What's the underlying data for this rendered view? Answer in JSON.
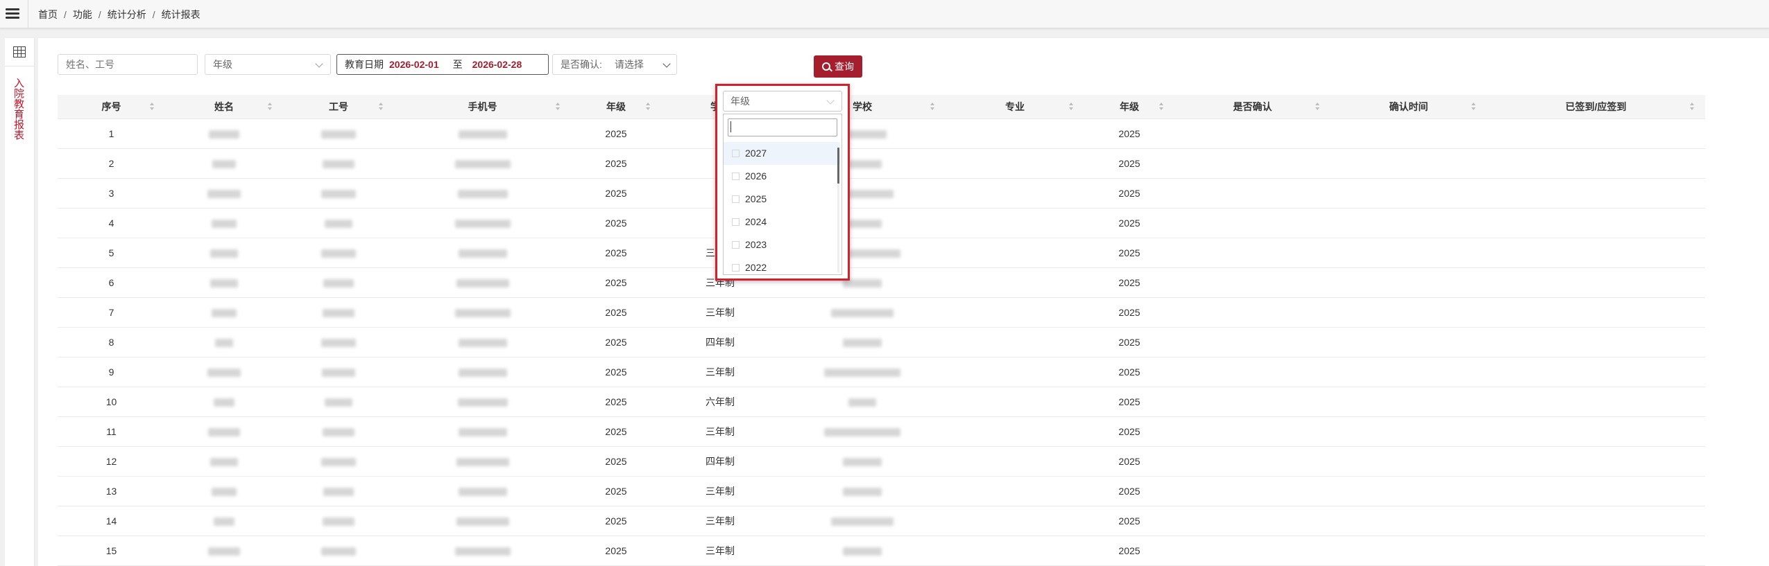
{
  "breadcrumb": [
    "首页",
    "功能",
    "统计分析",
    "统计报表"
  ],
  "sidebar": {
    "tab_label": "入院教育报表"
  },
  "filters": {
    "name_placeholder": "姓名、工号",
    "grade_placeholder": "年级",
    "edu_date_label": "教育日期",
    "date_start": "2026-02-01",
    "date_to": "至",
    "date_end": "2026-02-28",
    "confirm_label": "是否确认:",
    "confirm_value": "请选择",
    "grade2_placeholder": "年级",
    "query_label": "查询"
  },
  "dropdown": {
    "options": [
      "2027",
      "2026",
      "2025",
      "2024",
      "2023",
      "2022"
    ]
  },
  "table": {
    "columns": [
      "序号",
      "姓名",
      "工号",
      "手机号",
      "年级",
      "学制",
      "学校",
      "专业",
      "年级",
      "是否确认",
      "确认时间",
      "已签到/应签到"
    ],
    "rows": [
      {
        "no": "1",
        "grade": "2025",
        "system": "",
        "grade2": "2025"
      },
      {
        "no": "2",
        "grade": "2025",
        "system": "",
        "grade2": "2025"
      },
      {
        "no": "3",
        "grade": "2025",
        "system": "",
        "grade2": "2025"
      },
      {
        "no": "4",
        "grade": "2025",
        "system": "",
        "grade2": "2025"
      },
      {
        "no": "5",
        "grade": "2025",
        "system": "三年制",
        "grade2": "2025"
      },
      {
        "no": "6",
        "grade": "2025",
        "system": "三年制",
        "grade2": "2025"
      },
      {
        "no": "7",
        "grade": "2025",
        "system": "三年制",
        "grade2": "2025"
      },
      {
        "no": "8",
        "grade": "2025",
        "system": "四年制",
        "grade2": "2025"
      },
      {
        "no": "9",
        "grade": "2025",
        "system": "三年制",
        "grade2": "2025"
      },
      {
        "no": "10",
        "grade": "2025",
        "system": "六年制",
        "grade2": "2025"
      },
      {
        "no": "11",
        "grade": "2025",
        "system": "三年制",
        "grade2": "2025"
      },
      {
        "no": "12",
        "grade": "2025",
        "system": "四年制",
        "grade2": "2025"
      },
      {
        "no": "13",
        "grade": "2025",
        "system": "三年制",
        "grade2": "2025"
      },
      {
        "no": "14",
        "grade": "2025",
        "system": "三年制",
        "grade2": "2025"
      },
      {
        "no": "15",
        "grade": "2025",
        "system": "三年制",
        "grade2": "2025"
      }
    ]
  }
}
